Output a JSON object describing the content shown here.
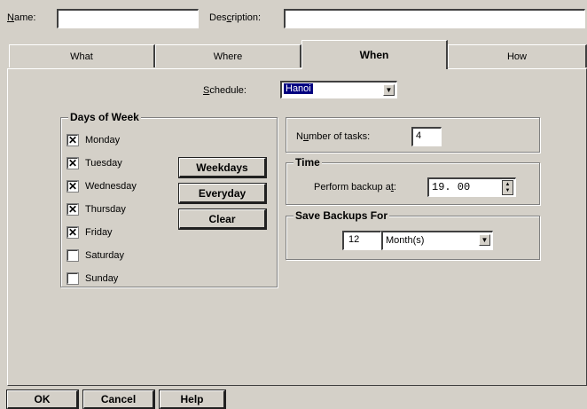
{
  "header": {
    "name_label_pre": "",
    "name_label_u": "N",
    "name_label_post": "ame:",
    "name_value": "",
    "description_label_pre": "Des",
    "description_label_u": "c",
    "description_label_post": "ription:",
    "description_value": ""
  },
  "tabs": [
    {
      "label": "What"
    },
    {
      "label": "Where"
    },
    {
      "label": "When"
    },
    {
      "label": "How"
    }
  ],
  "schedule": {
    "label_u": "S",
    "label_post": "chedule:",
    "selected": "Hanoi"
  },
  "days": {
    "title": "Days of Week",
    "items": [
      {
        "label": "Monday",
        "mark": "✕"
      },
      {
        "label": "Tuesday",
        "mark": "✕"
      },
      {
        "label": "Wednesday",
        "mark": "✕"
      },
      {
        "label": "Thursday",
        "mark": "✕"
      },
      {
        "label": "Friday",
        "mark": "✕"
      },
      {
        "label": "Saturday",
        "mark": ""
      },
      {
        "label": "Sunday",
        "mark": ""
      }
    ],
    "weekdays_btn": "Weekdays",
    "everyday_btn": "Everyday",
    "clear_btn": "Clear"
  },
  "tasks": {
    "label_pre": "N",
    "label_u": "u",
    "label_post": "mber of tasks:",
    "value": "4"
  },
  "time": {
    "title": "Time",
    "label_pre": "Perform backup a",
    "label_u": "t",
    "label_post": ":",
    "value": "19. 00"
  },
  "save": {
    "title": "Save Backups For",
    "count": "12",
    "unit": "Month(s)"
  },
  "footer": {
    "ok": "OK",
    "cancel": "Cancel",
    "help": "Help"
  }
}
